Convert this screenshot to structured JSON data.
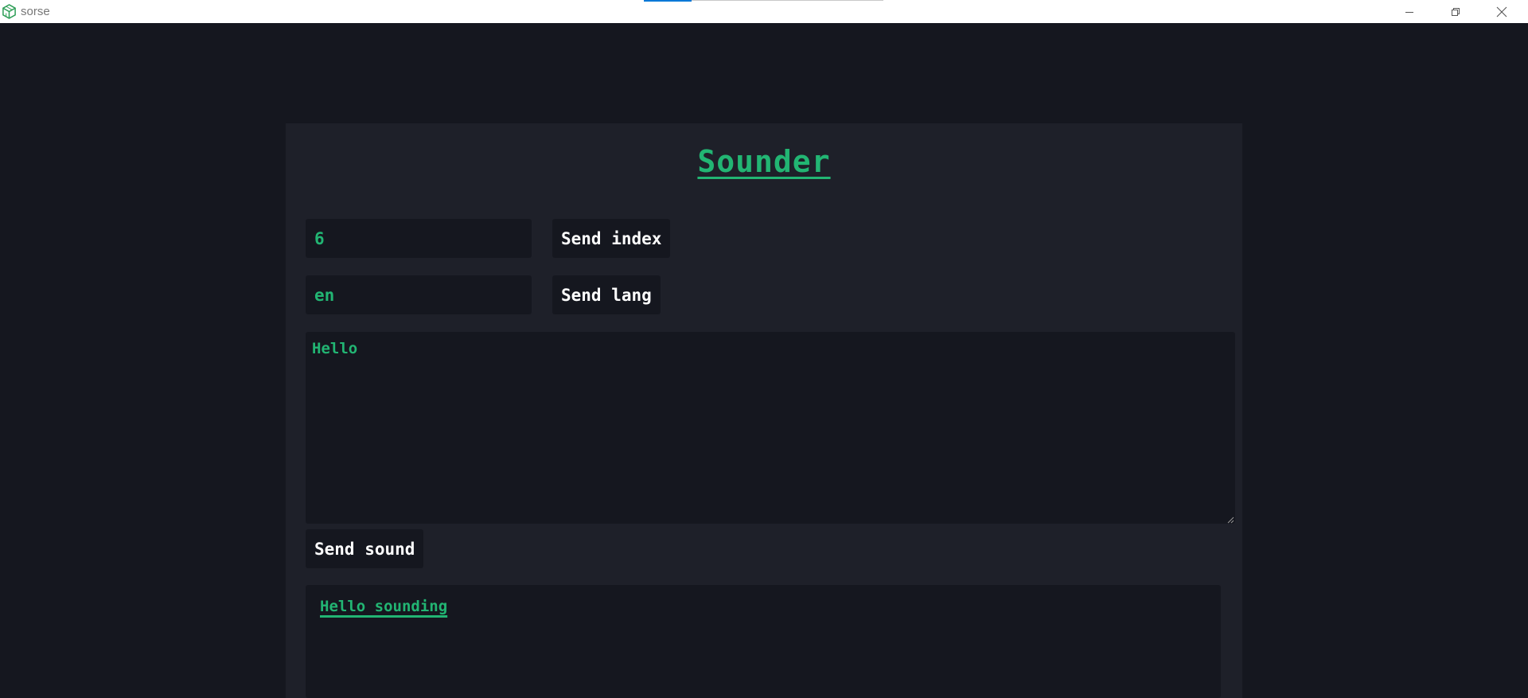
{
  "window": {
    "title": "sorse",
    "icon": "app-cube-icon",
    "controls": [
      "minimize-icon",
      "restore-icon",
      "close-icon"
    ]
  },
  "app": {
    "heading": "Sounder",
    "index_value": "6",
    "send_index_label": "Send index",
    "lang_value": "en",
    "send_lang_label": "Send lang",
    "message_value": "Hello",
    "send_sound_label": "Send sound",
    "output": [
      "Hello sounding"
    ]
  },
  "colors": {
    "accent": "#22b573",
    "page_background": "#15171f",
    "panel_background": "#1e2029",
    "button_text": "#ffffff"
  }
}
